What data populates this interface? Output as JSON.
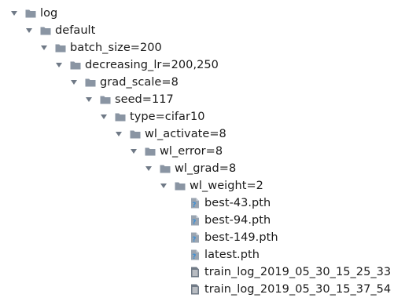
{
  "tree": [
    {
      "label": "log",
      "depth": 0,
      "type": "folder",
      "expanded": true,
      "icon": "folder-icon"
    },
    {
      "label": "default",
      "depth": 1,
      "type": "folder",
      "expanded": true,
      "icon": "folder-icon"
    },
    {
      "label": "batch_size=200",
      "depth": 2,
      "type": "folder",
      "expanded": true,
      "icon": "folder-icon"
    },
    {
      "label": "decreasing_lr=200,250",
      "depth": 3,
      "type": "folder",
      "expanded": true,
      "icon": "folder-icon"
    },
    {
      "label": "grad_scale=8",
      "depth": 4,
      "type": "folder",
      "expanded": true,
      "icon": "folder-icon"
    },
    {
      "label": "seed=117",
      "depth": 5,
      "type": "folder",
      "expanded": true,
      "icon": "folder-icon"
    },
    {
      "label": "type=cifar10",
      "depth": 6,
      "type": "folder",
      "expanded": true,
      "icon": "folder-icon"
    },
    {
      "label": "wl_activate=8",
      "depth": 7,
      "type": "folder",
      "expanded": true,
      "icon": "folder-icon"
    },
    {
      "label": "wl_error=8",
      "depth": 8,
      "type": "folder",
      "expanded": true,
      "icon": "folder-icon"
    },
    {
      "label": "wl_grad=8",
      "depth": 9,
      "type": "folder",
      "expanded": true,
      "icon": "folder-icon"
    },
    {
      "label": "wl_weight=2",
      "depth": 10,
      "type": "folder",
      "expanded": true,
      "icon": "folder-icon"
    },
    {
      "label": "best-43.pth",
      "depth": 11,
      "type": "unknown-file",
      "icon": "unknown-file-icon"
    },
    {
      "label": "best-94.pth",
      "depth": 11,
      "type": "unknown-file",
      "icon": "unknown-file-icon"
    },
    {
      "label": "best-149.pth",
      "depth": 11,
      "type": "unknown-file",
      "icon": "unknown-file-icon"
    },
    {
      "label": "latest.pth",
      "depth": 11,
      "type": "unknown-file",
      "icon": "unknown-file-icon"
    },
    {
      "label": "train_log_2019_05_30_15_25_33",
      "depth": 11,
      "type": "text-file",
      "icon": "text-file-icon"
    },
    {
      "label": "train_log_2019_05_30_15_37_54",
      "depth": 11,
      "type": "text-file",
      "icon": "text-file-icon"
    }
  ],
  "colors": {
    "folder": "#8a95a3",
    "arrow": "#6f7986",
    "unknown_file": "#9aa4b0",
    "unknown_mark": "#3d8fd6",
    "text_file": "#707a86"
  }
}
